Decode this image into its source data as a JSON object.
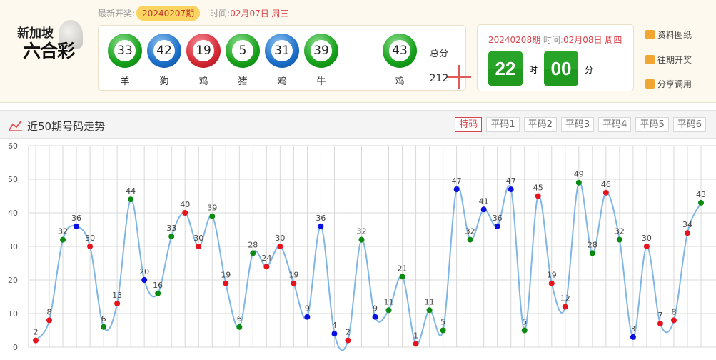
{
  "header": {
    "logo_line1": "新加坡",
    "logo_line2": "六合彩",
    "latest_label": "最新开奖:",
    "latest_issue": "20240207期",
    "time_label": "时间:",
    "latest_time": "02月07日 周三",
    "balls": [
      {
        "num": "33",
        "zodiac": "羊",
        "color": "g"
      },
      {
        "num": "42",
        "zodiac": "狗",
        "color": "b"
      },
      {
        "num": "19",
        "zodiac": "鸡",
        "color": "r"
      },
      {
        "num": "5",
        "zodiac": "猪",
        "color": "g"
      },
      {
        "num": "31",
        "zodiac": "鸡",
        "color": "b"
      },
      {
        "num": "39",
        "zodiac": "牛",
        "color": "g"
      }
    ],
    "plus_zodiac": "--",
    "special": {
      "num": "43",
      "zodiac": "鸡",
      "color": "g"
    },
    "total_label": "总分",
    "total": "212",
    "next_issue": "20240208期",
    "next_time_label": "时间:",
    "next_time": "02月08日 周四",
    "hour": "22",
    "hour_unit": "时",
    "minute": "00",
    "minute_unit": "分",
    "links": [
      "资料图纸",
      "往期开奖",
      "分享调用"
    ]
  },
  "chart_header": {
    "title": "近50期号码走势",
    "tabs": [
      "特码",
      "平码1",
      "平码2",
      "平码3",
      "平码4",
      "平码5",
      "平码6"
    ],
    "active_tab": 0
  },
  "colors": {
    "red": "#e8141d",
    "green": "#0a8a10",
    "blue": "#0a10e0",
    "line": "#7fb6e6"
  },
  "chart_data": {
    "type": "line",
    "ylim": [
      0,
      60
    ],
    "yticks": [
      0,
      10,
      20,
      30,
      40,
      50,
      60
    ],
    "grid": true,
    "values": [
      2,
      8,
      32,
      36,
      30,
      6,
      13,
      44,
      20,
      16,
      33,
      40,
      30,
      39,
      19,
      6,
      28,
      24,
      30,
      19,
      9,
      36,
      4,
      2,
      32,
      9,
      11,
      21,
      1,
      11,
      5,
      47,
      32,
      41,
      36,
      47,
      5,
      45,
      19,
      12,
      49,
      28,
      46,
      32,
      3,
      30,
      7,
      8,
      34,
      43
    ],
    "point_colors": [
      "red",
      "red",
      "green",
      "blue",
      "red",
      "green",
      "red",
      "green",
      "blue",
      "green",
      "green",
      "red",
      "red",
      "green",
      "red",
      "green",
      "green",
      "red",
      "red",
      "red",
      "blue",
      "blue",
      "blue",
      "red",
      "green",
      "blue",
      "green",
      "green",
      "red",
      "green",
      "green",
      "blue",
      "green",
      "blue",
      "blue",
      "blue",
      "green",
      "red",
      "red",
      "red",
      "green",
      "green",
      "red",
      "green",
      "blue",
      "red",
      "red",
      "red",
      "red",
      "green"
    ]
  }
}
